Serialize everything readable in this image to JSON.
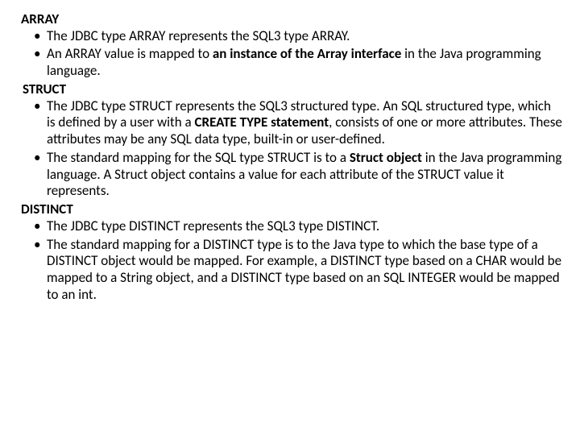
{
  "sections": {
    "array": {
      "heading": "ARRAY",
      "b1_pre": "The JDBC type ARRAY represents the SQL3 type ARRAY.",
      "b2_pre": "An ARRAY value is mapped to ",
      "b2_bold": "an instance of the Array interface",
      "b2_post": " in the Java programming language."
    },
    "struct": {
      "heading": "STRUCT",
      "b1_pre": "The JDBC type STRUCT represents the SQL3 structured type. An SQL structured type, which is defined by a user with a ",
      "b1_bold": "CREATE TYPE statement",
      "b1_post": ", consists of one or more attributes. These attributes may be any SQL data type, built-in or user-defined.",
      "b2_pre": "The standard mapping for the SQL type STRUCT is to a ",
      "b2_bold": "Struct object",
      "b2_post": " in the Java programming language. A Struct object contains a value for each attribute of the STRUCT value it represents."
    },
    "distinct": {
      "heading": "DISTINCT",
      "b1_pre": "The JDBC type DISTINCT  represents the SQL3 type DISTINCT.",
      "b2_pre": "The standard mapping for a DISTINCT type is to the Java type to which the base type of a DISTINCT object would be mapped. For example, a DISTINCT type based on a CHAR would be mapped to a String object, and a DISTINCT type based on an SQL INTEGER would be mapped to an int."
    }
  }
}
